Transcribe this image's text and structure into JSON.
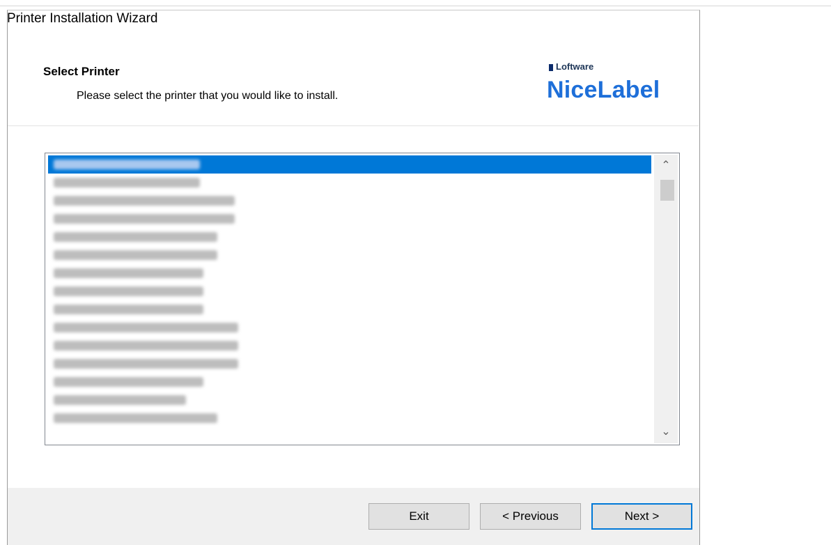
{
  "window": {
    "title": "Printer Installation Wizard"
  },
  "header": {
    "title": "Select Printer",
    "subtitle": "Please select the printer that you would like to install."
  },
  "logo": {
    "brand": "Loftware",
    "product": "NiceLabel"
  },
  "printer_list": {
    "selected_index": 0,
    "items": [
      "",
      "",
      "",
      "",
      "",
      "",
      "",
      "",
      "",
      "",
      "",
      "",
      "",
      "",
      ""
    ]
  },
  "buttons": {
    "exit": "Exit",
    "previous": "< Previous",
    "next": "Next >"
  },
  "colors": {
    "selection": "#0078d7",
    "logo_blue": "#1e6fd9"
  }
}
